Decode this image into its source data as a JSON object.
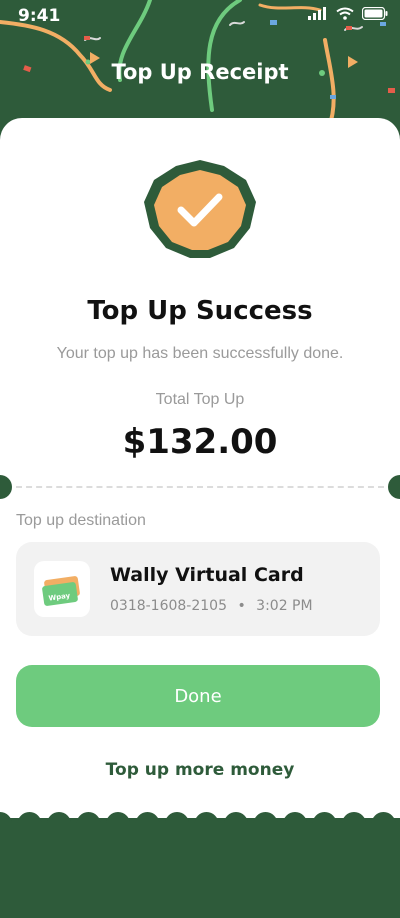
{
  "status_bar": {
    "time": "9:41"
  },
  "header": {
    "title": "Top Up Receipt"
  },
  "success": {
    "title": "Top Up Success",
    "subtitle": "Your top up has been successfully done.",
    "total_label": "Total Top Up",
    "total_amount": "$132.00"
  },
  "destination": {
    "label": "Top up destination",
    "card_name": "Wally Virtual Card",
    "card_number": "0318-1608-2105",
    "separator": "•",
    "time": "3:02 PM",
    "thumb_text": "Wpay"
  },
  "actions": {
    "done_label": "Done",
    "more_label": "Top up more money"
  },
  "colors": {
    "background": "#2e5b3a",
    "badge": "#f2ae64",
    "button": "#6ecb7e"
  }
}
